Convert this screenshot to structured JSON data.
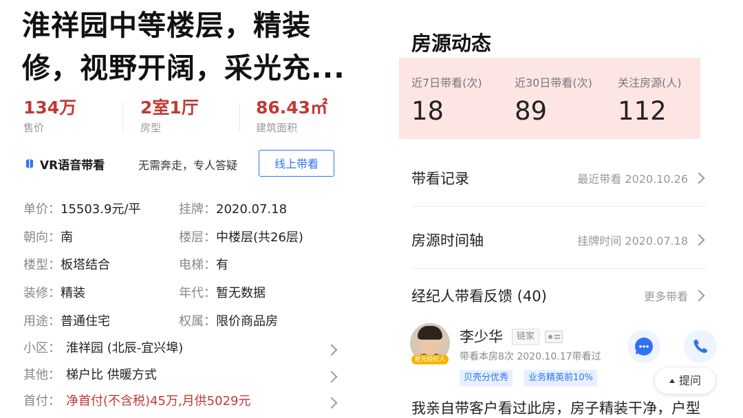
{
  "listing": {
    "title": "淮祥园中等楼层，精装修，视野开阔，采光充...",
    "stats": [
      {
        "value": "134万",
        "label": "售价"
      },
      {
        "value": "2室1厅",
        "label": "房型"
      },
      {
        "value": "86.43㎡",
        "label": "建筑面积"
      }
    ],
    "vr": {
      "title": "VR语音带看",
      "subtitle": "无需奔走，专人答疑",
      "button": "线上带看"
    },
    "details": [
      {
        "key": "单价：",
        "value": "15503.9元/平"
      },
      {
        "key": "挂牌：",
        "value": "2020.07.18"
      },
      {
        "key": "朝向：",
        "value": "南"
      },
      {
        "key": "楼层：",
        "value": "中楼层(共26层)"
      },
      {
        "key": "楼型：",
        "value": "板塔结合"
      },
      {
        "key": "电梯：",
        "value": "有"
      },
      {
        "key": "装修：",
        "value": "精装"
      },
      {
        "key": "年代：",
        "value": "暂无数据"
      },
      {
        "key": "用途：",
        "value": "普通住宅"
      },
      {
        "key": "权属：",
        "value": "限价商品房"
      }
    ],
    "links": [
      {
        "key": "小区：",
        "value": "淮祥园 (北辰-宜兴埠)"
      },
      {
        "key": "其他：",
        "value": "梯户比 供暖方式"
      },
      {
        "key": "首付：",
        "value": "净首付(不含税)45万,月供5029元"
      }
    ]
  },
  "dynamics": {
    "heading": "房源动态",
    "stats": [
      {
        "label": "近7日带看(次)",
        "value": "18"
      },
      {
        "label": "近30日带看(次)",
        "value": "89"
      },
      {
        "label": "关注房源(人)",
        "value": "112"
      }
    ],
    "rows": [
      {
        "title": "带看记录",
        "meta": "最近带看 2020.10.26"
      },
      {
        "title": "房源时间轴",
        "meta": "挂牌时间 2020.07.18"
      },
      {
        "title": "经纪人带看反馈 (40)",
        "meta": "更多带看"
      }
    ],
    "agent": {
      "name": "李少华",
      "brand": "链家",
      "star_badge": "星光经纪人",
      "meta": "带看本房8次 2020.10.17带看过",
      "chips": [
        "贝壳分优秀",
        "业务精英前10%"
      ]
    },
    "ask_button": "提问",
    "comment_preview": "我亲自带客户看过此房，房子精装干净，户型"
  },
  "colors": {
    "accent_red": "#c23934",
    "accent_blue": "#3072f6",
    "highlight_pink": "#fce5e3"
  }
}
